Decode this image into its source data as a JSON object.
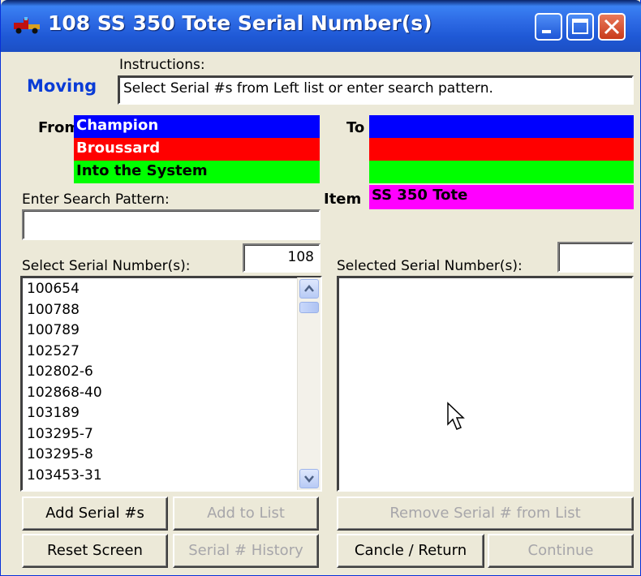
{
  "window": {
    "title": "108 SS 350 Tote Serial Number(s)"
  },
  "header": {
    "mode": "Moving",
    "instructions_label": "Instructions:",
    "instructions_text": "Select Serial #s from Left list or enter search pattern."
  },
  "from": {
    "label": "From",
    "bars": [
      {
        "text": "Champion",
        "color": "#0000ff"
      },
      {
        "text": "Broussard",
        "color": "#ff0000"
      },
      {
        "text": "Into the System",
        "color": "#00ff00"
      }
    ]
  },
  "to": {
    "label": "To",
    "bars": [
      {
        "text": "",
        "color": "#0000ff"
      },
      {
        "text": "",
        "color": "#ff0000"
      },
      {
        "text": "",
        "color": "#00ff00"
      }
    ]
  },
  "item": {
    "label": "Item",
    "value": "SS 350 Tote",
    "color": "#ff00ff"
  },
  "search": {
    "label": "Enter Search Pattern:",
    "value": ""
  },
  "left_list": {
    "label": "Select Serial Number(s):",
    "count": "108",
    "items": [
      "100654",
      "100788",
      "100789",
      "102527",
      "102802-6",
      "102868-40",
      "103189",
      "103295-7",
      "103295-8",
      "103453-31"
    ]
  },
  "right_list": {
    "label": "Selected Serial Number(s):",
    "count": "",
    "items": []
  },
  "buttons": {
    "add_serial": "Add Serial #s",
    "add_to_list": "Add to List",
    "remove_serial": "Remove Serial #  from List",
    "reset_screen": "Reset Screen",
    "serial_history": "Serial # History",
    "cancel_return": "Cancle / Return",
    "continue": "Continue"
  }
}
